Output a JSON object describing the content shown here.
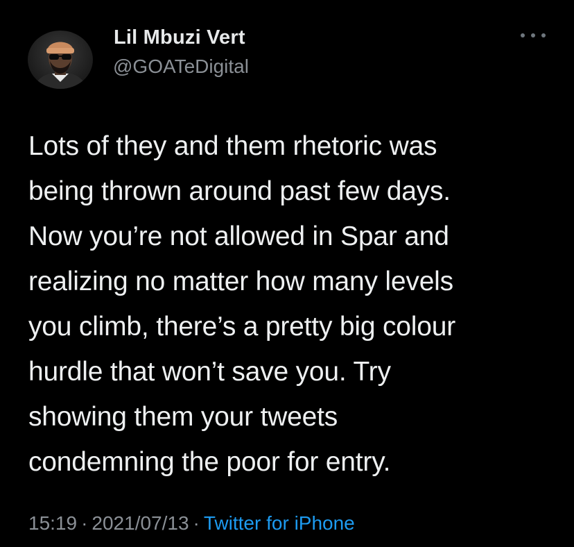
{
  "tweet": {
    "author": {
      "display_name": "Lil Mbuzi Vert",
      "handle": "@GOATeDigital",
      "avatar_icon": "user-avatar"
    },
    "more_icon": "more-horizontal-icon",
    "text": "Lots of they and them rhetoric was\nbeing thrown around past few days.\nNow you’re not allowed in Spar and\nrealizing no matter how many levels\nyou climb, there’s a pretty big colour\nhurdle that won’t save you. Try\nshowing them your tweets\ncondemning the poor for entry.",
    "time": "15:19",
    "date": "2021/07/13",
    "separator": "·",
    "source": "Twitter for iPhone"
  },
  "colors": {
    "background": "#000000",
    "text": "#e7e9ea",
    "secondary_text": "#8b9096",
    "link": "#1d9bf0"
  }
}
